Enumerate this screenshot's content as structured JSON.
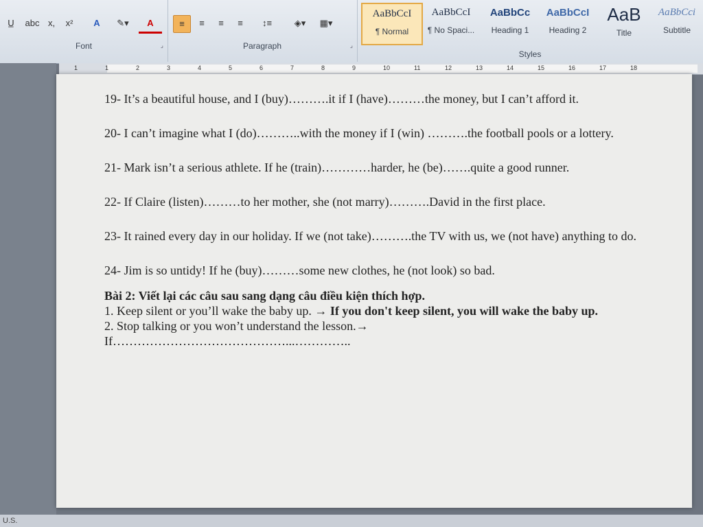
{
  "ribbon": {
    "font_group": {
      "label": "Font",
      "buttons": [
        "abc",
        "x,",
        "x²",
        "A",
        "A"
      ]
    },
    "paragraph_group": {
      "label": "Paragraph"
    },
    "styles_group": {
      "label": "Styles",
      "items": [
        {
          "sample": "AaBbCcI",
          "name": "¶ Normal"
        },
        {
          "sample": "AaBbCcI",
          "name": "¶ No Spaci..."
        },
        {
          "sample": "AaBbCc",
          "name": "Heading 1"
        },
        {
          "sample": "AaBbCcI",
          "name": "Heading 2"
        },
        {
          "sample": "AaB",
          "name": "Title"
        },
        {
          "sample": "AaBbCci",
          "name": "Subtitle"
        }
      ]
    }
  },
  "ruler": {
    "numbers": [
      "1",
      "1",
      "2",
      "3",
      "4",
      "5",
      "6",
      "7",
      "8",
      "9",
      "10",
      "11",
      "12",
      "13",
      "14",
      "15",
      "16",
      "17",
      "18"
    ]
  },
  "document": {
    "items": [
      {
        "text": "19- It’s a beautiful house, and I (buy)……….it if I (have)………the money, but I can’t afford it."
      },
      {
        "text": "20- I can’t imagine what I (do)………..with the money if I (win) ……….the football pools or a lottery."
      },
      {
        "text": "21- Mark isn’t a serious athlete. If he (train)…………harder, he (be)…….quite a good runner."
      },
      {
        "text": "22- If Claire (listen)………to her mother, she (not marry)……….David in the first place."
      },
      {
        "text": "23- It rained every day in our holiday. If we (not take)……….the TV with us, we (not have) anything to do."
      },
      {
        "text": "24- Jim is so untidy! If he (buy)………some new clothes, he (not look) so bad."
      }
    ],
    "exercise_title": "Bài 2: Viết lại các câu sau sang dạng câu điều kiện thích hợp.",
    "ex1_prompt": "1. Keep silent or you’ll wake the baby up. → ",
    "ex1_answer": "If you don't keep silent, you will wake the baby up.",
    "ex2_prompt": "2. Stop talking or you won’t understand the lesson.→",
    "ex2_answer": "If……………………………………...………….."
  },
  "status": {
    "text": "U.S."
  }
}
